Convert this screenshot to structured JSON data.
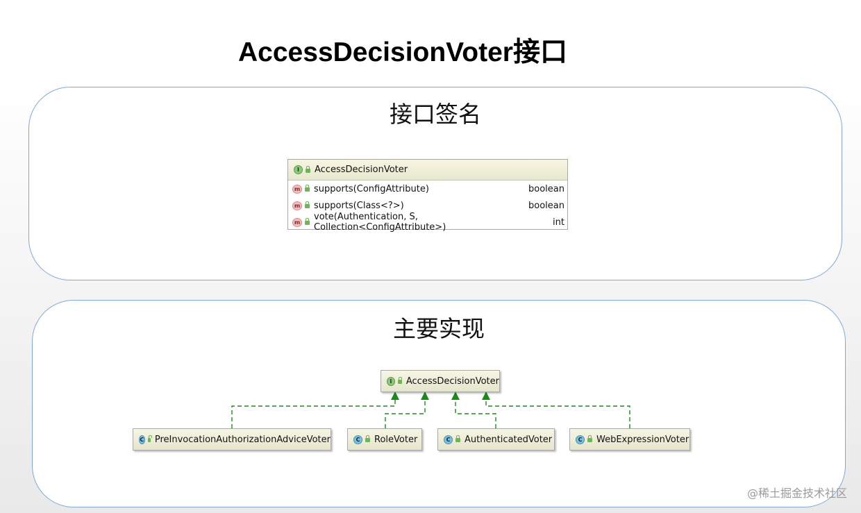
{
  "title": "AccessDecisionVoter接口",
  "signature_panel": {
    "title": "接口签名",
    "interface": {
      "badge": "I",
      "name": "AccessDecisionVoter",
      "methods": [
        {
          "badge": "m",
          "signature": "supports(ConfigAttribute)",
          "returns": "boolean"
        },
        {
          "badge": "m",
          "signature": "supports(Class<?>)",
          "returns": "boolean"
        },
        {
          "badge": "m",
          "signature": "vote(Authentication, S, Collection<ConfigAttribute>)",
          "returns": "int"
        }
      ]
    }
  },
  "implementation_panel": {
    "title": "主要实现",
    "root": {
      "badge": "I",
      "name": "AccessDecisionVoter"
    },
    "implementations": [
      {
        "badge": "C",
        "name": "PreInvocationAuthorizationAdviceVoter"
      },
      {
        "badge": "C",
        "name": "RoleVoter"
      },
      {
        "badge": "C",
        "name": "AuthenticatedVoter"
      },
      {
        "badge": "C",
        "name": "WebExpressionVoter"
      }
    ],
    "edge_style": "dashed",
    "edge_color": "#1a8a1a"
  },
  "watermark": "@稀土掘金技术社区"
}
